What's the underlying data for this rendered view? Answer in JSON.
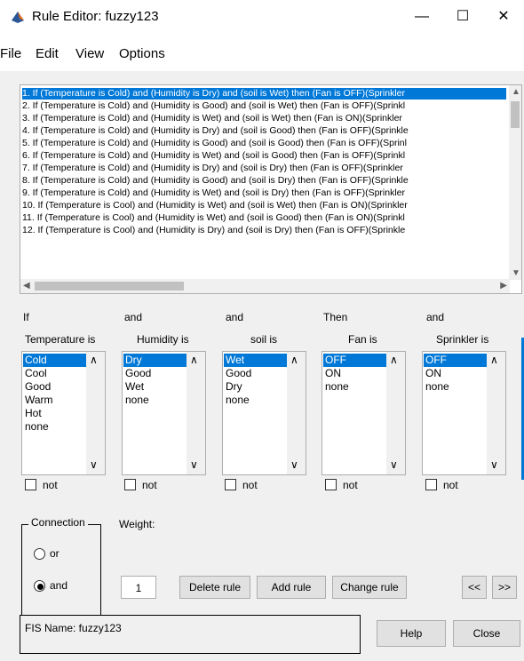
{
  "window": {
    "title": "Rule Editor: fuzzy123",
    "minimize": "—",
    "maximize": "☐",
    "close": "✕"
  },
  "menu": [
    "File",
    "Edit",
    "View",
    "Options"
  ],
  "rules": [
    "1. If (Temperature is Cold) and (Humidity is Dry) and (soil is Wet) then (Fan is OFF)(Sprinkler",
    "2. If (Temperature is Cold) and (Humidity is Good) and (soil is Wet) then (Fan is OFF)(Sprinkl",
    "3. If (Temperature is Cold) and (Humidity is Wet) and (soil is Wet) then (Fan is ON)(Sprinkler",
    "4. If (Temperature is Cold) and (Humidity is Dry) and (soil is Good) then (Fan is OFF)(Sprinkle",
    "5. If (Temperature is Cold) and (Humidity is Good) and (soil is Good) then (Fan is OFF)(Sprinl",
    "6. If (Temperature is Cold) and (Humidity is Wet) and (soil is Good) then (Fan is OFF)(Sprinkl",
    "7. If (Temperature is Cold) and (Humidity is Dry) and (soil is Dry) then (Fan is OFF)(Sprinkler",
    "8. If (Temperature is Cold) and (Humidity is Good) and (soil is Dry) then (Fan is OFF)(Sprinkle",
    "9. If (Temperature is Cold) and (Humidity is Wet) and (soil is Dry) then (Fan is OFF)(Sprinkler",
    "10. If (Temperature is Cool) and (Humidity is Wet) and (soil is Wet) then (Fan is ON)(Sprinkler",
    "11. If (Temperature is Cool) and (Humidity is Wet) and (soil is Good) then (Fan is ON)(Sprinkl",
    "12. If (Temperature is Cool) and (Humidity is Dry) and (soil is Dry) then (Fan is OFF)(Sprinkle"
  ],
  "columns": [
    {
      "connector": "If",
      "var": "Temperature is",
      "options": [
        "Cold",
        "Cool",
        "Good",
        "Warm",
        "Hot",
        "none"
      ],
      "not": "not"
    },
    {
      "connector": "and",
      "var": "Humidity is",
      "options": [
        "Dry",
        "Good",
        "Wet",
        "none"
      ],
      "not": "not"
    },
    {
      "connector": "and",
      "var": "soil is",
      "options": [
        "Wet",
        "Good",
        "Dry",
        "none"
      ],
      "not": "not"
    },
    {
      "connector": "Then",
      "var": "Fan is",
      "options": [
        "OFF",
        "ON",
        "none"
      ],
      "not": "not"
    },
    {
      "connector": "and",
      "var": "Sprinkler is",
      "options": [
        "OFF",
        "ON",
        "none"
      ],
      "not": "not"
    }
  ],
  "connection": {
    "label": "Connection",
    "or": "or",
    "and": "and",
    "selected": "and"
  },
  "weight": {
    "label": "Weight:",
    "value": "1"
  },
  "buttons": {
    "delete": "Delete rule",
    "add": "Add rule",
    "change": "Change rule",
    "prev": "<<",
    "next": ">>",
    "help": "Help",
    "close": "Close"
  },
  "status": "FIS Name: fuzzy123",
  "colors": {
    "selection": "#0078d7",
    "background": "#f0f0f0"
  }
}
